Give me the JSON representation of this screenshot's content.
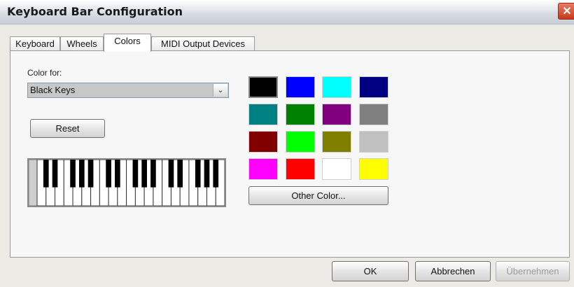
{
  "window": {
    "title": "Keyboard Bar Configuration",
    "close_glyph": "✕"
  },
  "tabs": [
    {
      "label": "Keyboard",
      "active": false
    },
    {
      "label": "Wheels",
      "active": false
    },
    {
      "label": "Colors",
      "active": true
    },
    {
      "label": "MIDI Output Devices",
      "active": false
    }
  ],
  "colors_tab": {
    "color_for_label": "Color for:",
    "selected_target": "Black Keys",
    "reset_label": "Reset",
    "other_color_label": "Other Color...",
    "swatches": [
      "#000000",
      "#0000ff",
      "#00ffff",
      "#000080",
      "#008080",
      "#008000",
      "#800080",
      "#808080",
      "#800000",
      "#00ff00",
      "#808000",
      "#c0c0c0",
      "#ff00ff",
      "#ff0000",
      "#ffffff",
      "#ffff00"
    ],
    "selected_swatch": "#000000",
    "keyboard_preview": {
      "white_keys": 21
    }
  },
  "dialog_buttons": {
    "ok_label": "OK",
    "cancel_label": "Abbrechen",
    "apply_label": "Übernehmen",
    "apply_enabled": false
  },
  "icons": {
    "dropdown": "chevron-down-icon",
    "close": "close-icon"
  }
}
